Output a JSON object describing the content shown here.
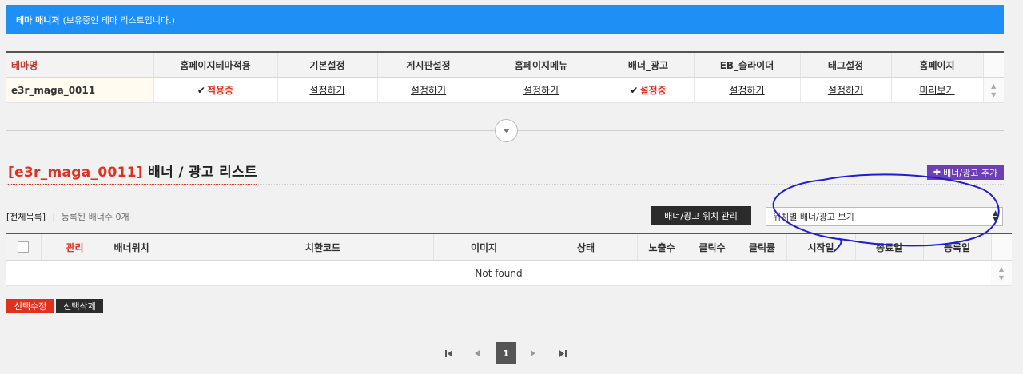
{
  "banner": {
    "title": "테마 매니저",
    "subtitle": "(보유중인 테마 리스트입니다.)"
  },
  "theme_table": {
    "headers": [
      "테마명",
      "홈페이지테마적용",
      "기본설정",
      "게시판설정",
      "홈페이지메뉴",
      "배너_광고",
      "EB_슬라이더",
      "태그설정",
      "홈페이지"
    ],
    "row": {
      "name": "e3r_maga_0011",
      "apply": "적용중",
      "basic": "설정하기",
      "board": "설정하기",
      "menu": "설정하기",
      "banner": "설정중",
      "slider": "설정하기",
      "tag": "설정하기",
      "home": "미리보기"
    }
  },
  "toggle_icon": "chevron-down-icon",
  "section": {
    "theme_name": "e3r_maga_0011",
    "title_bracket_open": "[",
    "title_bracket_close": "]",
    "title_text": " 배너 / 광고 리스트",
    "add_button": "배너/광고 추가",
    "all_list": "[전체목록]",
    "registered_count": "등록된 배너수 0개",
    "manage_button": "배너/광고 위치 관리",
    "select_value": "위치별 배너/광고 보기"
  },
  "banner_table": {
    "headers": [
      "",
      "관리",
      "배너위치",
      "치환코드",
      "이미지",
      "상태",
      "노출수",
      "클릭수",
      "클릭률",
      "시작일",
      "종료일",
      "등록일"
    ],
    "empty_text": "Not found"
  },
  "actions": {
    "edit": "선택수정",
    "delete": "선택삭제"
  },
  "pagination": {
    "first": "first-page-icon",
    "prev": "prev-page-icon",
    "current": "1",
    "next": "next-page-icon",
    "last": "last-page-icon"
  },
  "colors": {
    "banner_blue": "#1e90f5",
    "accent_red": "#e0301e",
    "add_purple": "#6c3fb5",
    "annotation_ink": "#1d1dd6"
  }
}
